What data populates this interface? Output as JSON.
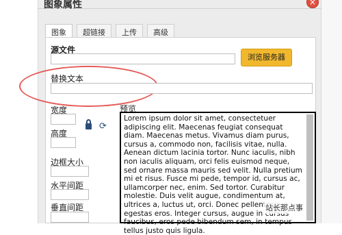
{
  "dialog": {
    "title": "图象属性",
    "close_symbol": "×"
  },
  "tabs": [
    {
      "label": "图象",
      "active": true
    },
    {
      "label": "超链接",
      "active": false
    },
    {
      "label": "上传",
      "active": false
    },
    {
      "label": "高级",
      "active": false
    }
  ],
  "form": {
    "source_label": "源文件",
    "source_value": "",
    "browse_button": "浏览服务器",
    "alt_label": "替换文本",
    "alt_value": "",
    "width_label": "宽度",
    "width_value": "",
    "height_label": "高度",
    "height_value": "",
    "border_label": "边框大小",
    "border_value": "",
    "hspace_label": "水平间距",
    "hspace_value": "",
    "vspace_label": "垂直间距",
    "vspace_value": ""
  },
  "icons": {
    "lock": "lock-icon",
    "refresh": "refresh-icon",
    "refresh_symbol": "⟳"
  },
  "preview": {
    "label": "预览",
    "text": "Lorem ipsum dolor sit amet, consectetuer adipiscing elit. Maecenas feugiat consequat diam. Maecenas metus. Vivamus diam purus, cursus a, commodo non, facilisis vitae, nulla. Aenean dictum lacinia tortor. Nunc iaculis, nibh non iaculis aliquam, orci felis euismod neque, sed ornare massa mauris sed velit. Nulla pretium mi et risus. Fusce mi pede, tempor id, cursus ac, ullamcorper nec, enim. Sed tortor. Curabitur molestie. Duis velit augue, condimentum at, ultrices a, luctus ut, orci. Donec pellentesque egestas eros. Integer cursus, augue in cursus faucibus, eros pede bibendum sem, in tempus tellus justo quis ligula."
  },
  "watermark": {
    "text": "站长那点事"
  },
  "colors": {
    "accent_button": "#f1b82e",
    "highlight": "#e45b58",
    "close_button": "#e05040"
  }
}
